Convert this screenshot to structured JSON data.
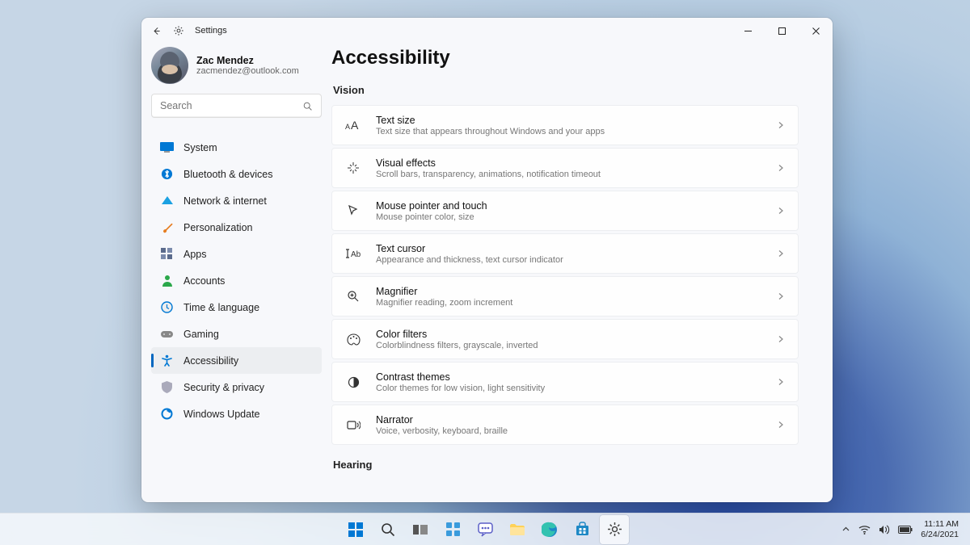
{
  "app_title": "Settings",
  "user": {
    "name": "Zac Mendez",
    "email": "zacmendez@outlook.com"
  },
  "search_placeholder": "Search",
  "nav": [
    {
      "label": "System"
    },
    {
      "label": "Bluetooth & devices"
    },
    {
      "label": "Network & internet"
    },
    {
      "label": "Personalization"
    },
    {
      "label": "Apps"
    },
    {
      "label": "Accounts"
    },
    {
      "label": "Time & language"
    },
    {
      "label": "Gaming"
    },
    {
      "label": "Accessibility"
    },
    {
      "label": "Security & privacy"
    },
    {
      "label": "Windows Update"
    }
  ],
  "page_title": "Accessibility",
  "sections": {
    "vision_header": "Vision",
    "hearing_header": "Hearing"
  },
  "vision_items": [
    {
      "title": "Text size",
      "sub": "Text size that appears throughout Windows and your apps"
    },
    {
      "title": "Visual effects",
      "sub": "Scroll bars, transparency, animations, notification timeout"
    },
    {
      "title": "Mouse pointer and touch",
      "sub": "Mouse pointer color, size"
    },
    {
      "title": "Text cursor",
      "sub": "Appearance and thickness, text cursor indicator"
    },
    {
      "title": "Magnifier",
      "sub": "Magnifier reading, zoom increment"
    },
    {
      "title": "Color filters",
      "sub": "Colorblindness filters, grayscale, inverted"
    },
    {
      "title": "Contrast themes",
      "sub": "Color themes for low vision, light sensitivity"
    },
    {
      "title": "Narrator",
      "sub": "Voice, verbosity, keyboard, braille"
    }
  ],
  "taskbar": {
    "time": "11:11 AM",
    "date": "6/24/2021"
  }
}
